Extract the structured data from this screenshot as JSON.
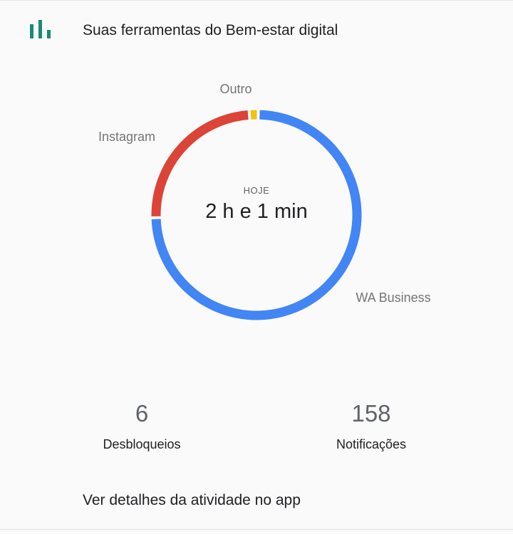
{
  "header": {
    "title": "Suas ferramentas do Bem-estar digital",
    "icon": "bar-chart-icon",
    "icon_color": "#1a8a7a"
  },
  "chart_data": {
    "type": "pie",
    "center_label": "HOJE",
    "center_value": "2 h e 1 min",
    "slices": [
      {
        "name": "WA Business",
        "value": 0.743,
        "color": "#4285f4"
      },
      {
        "name": "Instagram",
        "value": 0.243,
        "color": "#db4437"
      },
      {
        "name": "Outro",
        "value": 0.014,
        "color": "#f4c20d"
      }
    ]
  },
  "stats": {
    "unlocks_value": "6",
    "unlocks_label": "Desbloqueios",
    "notifications_value": "158",
    "notifications_label": "Notificações"
  },
  "link": {
    "label": "Ver detalhes da atividade no app"
  }
}
